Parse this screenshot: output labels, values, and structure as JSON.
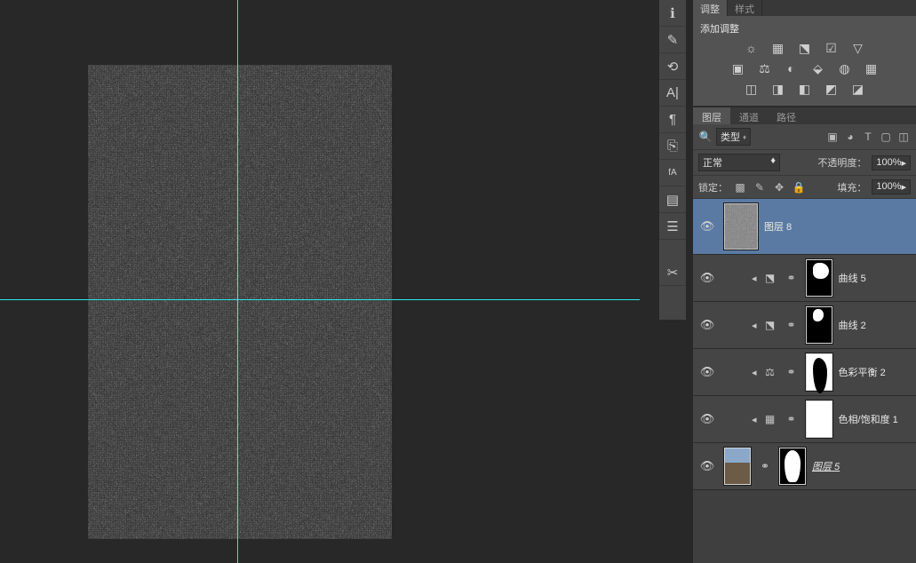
{
  "adjustments_panel": {
    "tabs": {
      "adjustments": "调整",
      "styles": "样式"
    },
    "title": "添加调整",
    "icons": [
      "brightness-contrast",
      "levels",
      "curves",
      "exposure",
      "filter",
      "triangle",
      "color-balance",
      "hue-sat",
      "black-white",
      "channel-mixer",
      "lookup",
      "pattern",
      "selective",
      "gradient-map",
      "gradient",
      "posterize",
      "threshold"
    ]
  },
  "layers_panel": {
    "tabs": {
      "layers": "图层",
      "channels": "通道",
      "paths": "路径"
    },
    "filter": {
      "kind_label": "类型",
      "icons": [
        "image",
        "fx",
        "type",
        "shape",
        "smart"
      ]
    },
    "blend": {
      "mode": "正常",
      "opacity_label": "不透明度：",
      "opacity_value": "100%"
    },
    "lock": {
      "label": "锁定：",
      "fill_label": "填充：",
      "fill_value": "100%"
    }
  },
  "layers": [
    {
      "id": "l8",
      "type": "pixel",
      "name": "图层  8",
      "selected": true,
      "thumb": "noise"
    },
    {
      "id": "curves5",
      "type": "adjustment",
      "name": "曲线  5",
      "adj_icon": "curves",
      "mask": "mask-blob1"
    },
    {
      "id": "curves2",
      "type": "adjustment",
      "name": "曲线  2",
      "adj_icon": "curves",
      "mask": "mask-blob2"
    },
    {
      "id": "cb2",
      "type": "adjustment",
      "name": "色彩平衡  2",
      "adj_icon": "balance",
      "mask": "mask-blob3"
    },
    {
      "id": "hue1",
      "type": "adjustment",
      "name": "色相/饱和度  1",
      "adj_icon": "huesat",
      "mask": "white"
    },
    {
      "id": "l5",
      "type": "pixel-mask",
      "name": "图层  5",
      "italic": true,
      "thumb": "person",
      "mask": "mask-silhouette"
    }
  ],
  "toolstrip": [
    "info",
    "swap",
    "history",
    "type",
    "char",
    "para",
    "attach",
    "align",
    "notes",
    "library",
    "ruler",
    "script"
  ]
}
